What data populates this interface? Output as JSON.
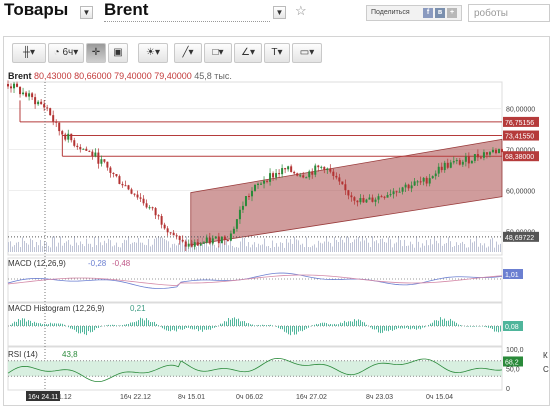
{
  "header": {
    "section_title": "Товары",
    "instrument": "Brent",
    "share_label": "Поделиться",
    "search_placeholder": "роботы"
  },
  "toolbar": {
    "interval_label": "6ч"
  },
  "quote": {
    "symbol": "Brent",
    "open": "80,43000",
    "high": "80,66000",
    "low": "79,40000",
    "close": "79,40000",
    "volume": "45,8 тыс."
  },
  "panels": {
    "macd_title": "MACD (12,26,9)",
    "macd_value": "-0,28",
    "macd_signal": "-0,48",
    "macd_tag": "1,01",
    "hist_title": "MACD Histogram (12,26,9)",
    "hist_value": "0,21",
    "hist_tag": "0,08",
    "rsi_title": "RSI (14)",
    "rsi_value": "43,8",
    "rsi_tag": "68,2"
  },
  "chart_data": {
    "type": "line",
    "price_axis": [
      "80,00000",
      "70,00000",
      "60,00000",
      "50,00000"
    ],
    "rsi_axis": [
      "100,0",
      "50,0",
      "0"
    ],
    "price_tags": [
      "76,75156",
      "73,41550",
      "68,38000",
      "48,69722"
    ],
    "time_labels": [
      "16ч 24.11",
      "1.12",
      "16ч 22.12",
      "8ч 15.01",
      "0ч 06.02",
      "16ч 27.02",
      "8ч 23.03",
      "0ч 15.04"
    ],
    "price_range": [
      45,
      86
    ],
    "support_lines": [
      76.75,
      73.42,
      68.38
    ],
    "channel": {
      "x0": 0.37,
      "x1": 1.0,
      "lower": [
        46.7,
        58.5
      ],
      "upper": [
        59.5,
        72.5
      ]
    },
    "colors": {
      "candle_up": "#2a8a3a",
      "candle_down": "#b33232",
      "channel": "#b05a5a",
      "lines": "#b53b3b",
      "macd": "#6b7fd1",
      "signal": "#d48aa8",
      "hist": "#4fb59b",
      "rsi": "#2a8a3a"
    }
  },
  "side_notes": [
    "К",
    "С",
    "0"
  ]
}
